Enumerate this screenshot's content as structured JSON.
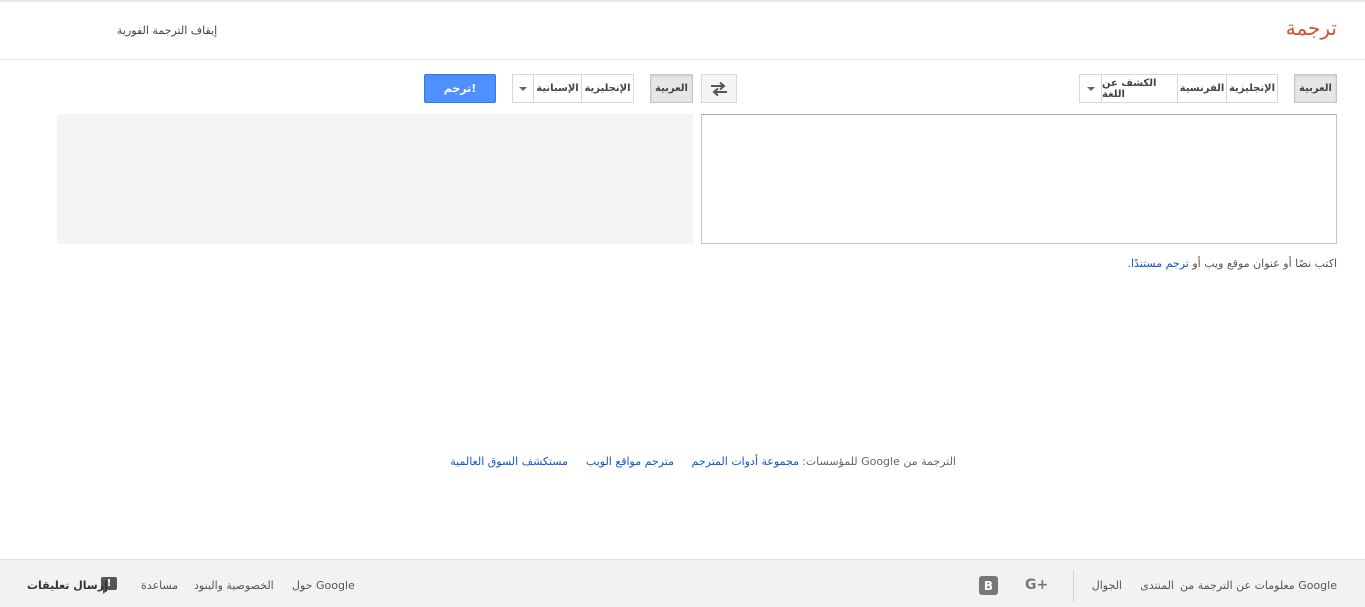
{
  "header": {
    "brand": "ترجمة",
    "instant_toggle": "إيقاف الترجمة الفورية"
  },
  "source_langs": {
    "items": [
      "العربية",
      "الإنجليزية",
      "الفرنسية",
      "الكشف عن اللغة"
    ],
    "selected": "العربية"
  },
  "target_langs": {
    "items": [
      "العربية",
      "الإنجليزية",
      "الإسبانية"
    ],
    "selected": "العربية"
  },
  "translate_button": "ترجم!",
  "hint": {
    "prefix": "اكتب نصًا أو عنوان موقع ويب أو ",
    "link": "ترجم مستندًا",
    "suffix": "."
  },
  "business": {
    "label": "الترجمة من Google للمؤسسات:",
    "links": [
      "مجموعة أدوات المترجم",
      "مترجم مواقع الويب",
      "مستكشف السوق العالمية"
    ]
  },
  "footer": {
    "about_translate": "معلومات عن الترجمة من Google",
    "community": "المنتدى",
    "mobile": "الجوال",
    "about_google": "حول Google",
    "privacy": "الخصوصية والبنود",
    "help": "مساعدة",
    "feedback": "إرسال تعليقات"
  },
  "colors": {
    "brand": "#dd4b39",
    "primary_button": "#4d90fe",
    "link": "#1155cc"
  },
  "icons": [
    "swap-icon",
    "dropdown-arrow-icon",
    "blogger-icon",
    "google-plus-icon",
    "feedback-icon"
  ]
}
